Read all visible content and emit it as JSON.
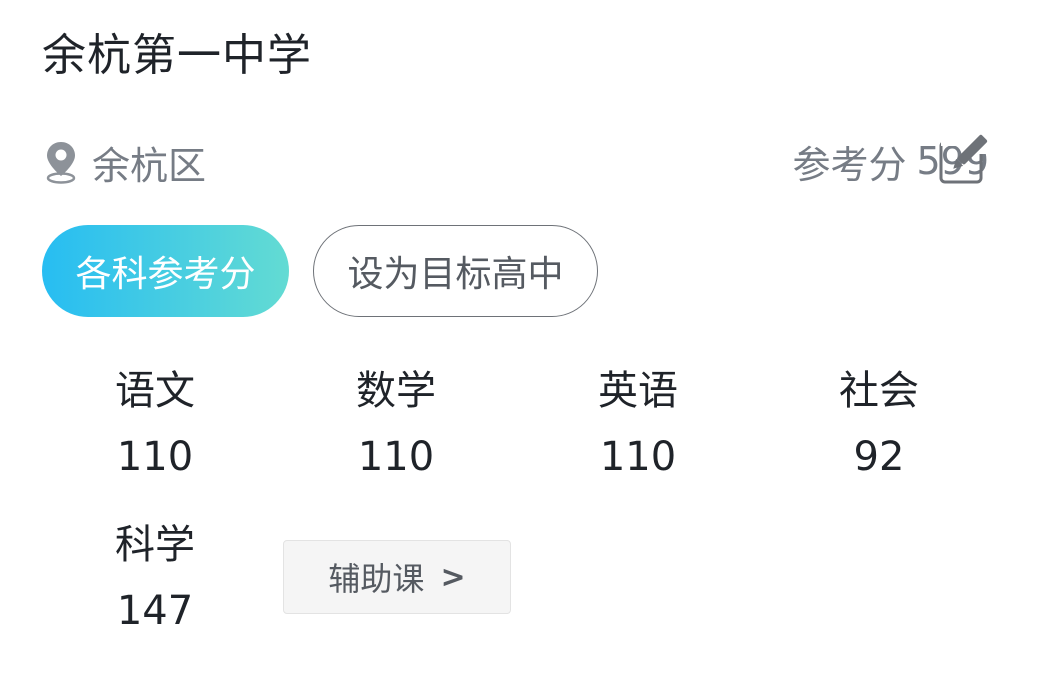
{
  "school": {
    "name": "余杭第一中学"
  },
  "location": {
    "icon": "location-pin-icon",
    "district": "余杭区"
  },
  "reference": {
    "label": "参考分",
    "score": "599",
    "edit_icon": "edit-icon"
  },
  "actions": {
    "primary_label": "各科参考分",
    "secondary_label": "设为目标高中"
  },
  "subjects": [
    {
      "name": "语文",
      "score": "110"
    },
    {
      "name": "数学",
      "score": "110"
    },
    {
      "name": "英语",
      "score": "110"
    },
    {
      "name": "社会",
      "score": "92"
    },
    {
      "name": "科学",
      "score": "147"
    }
  ],
  "aux": {
    "label": "辅助课",
    "chevron": ">"
  },
  "colors": {
    "gradient_start": "#27bdf2",
    "gradient_end": "#63dbd3",
    "muted_text": "#767c85",
    "main_text": "#1f2329"
  }
}
